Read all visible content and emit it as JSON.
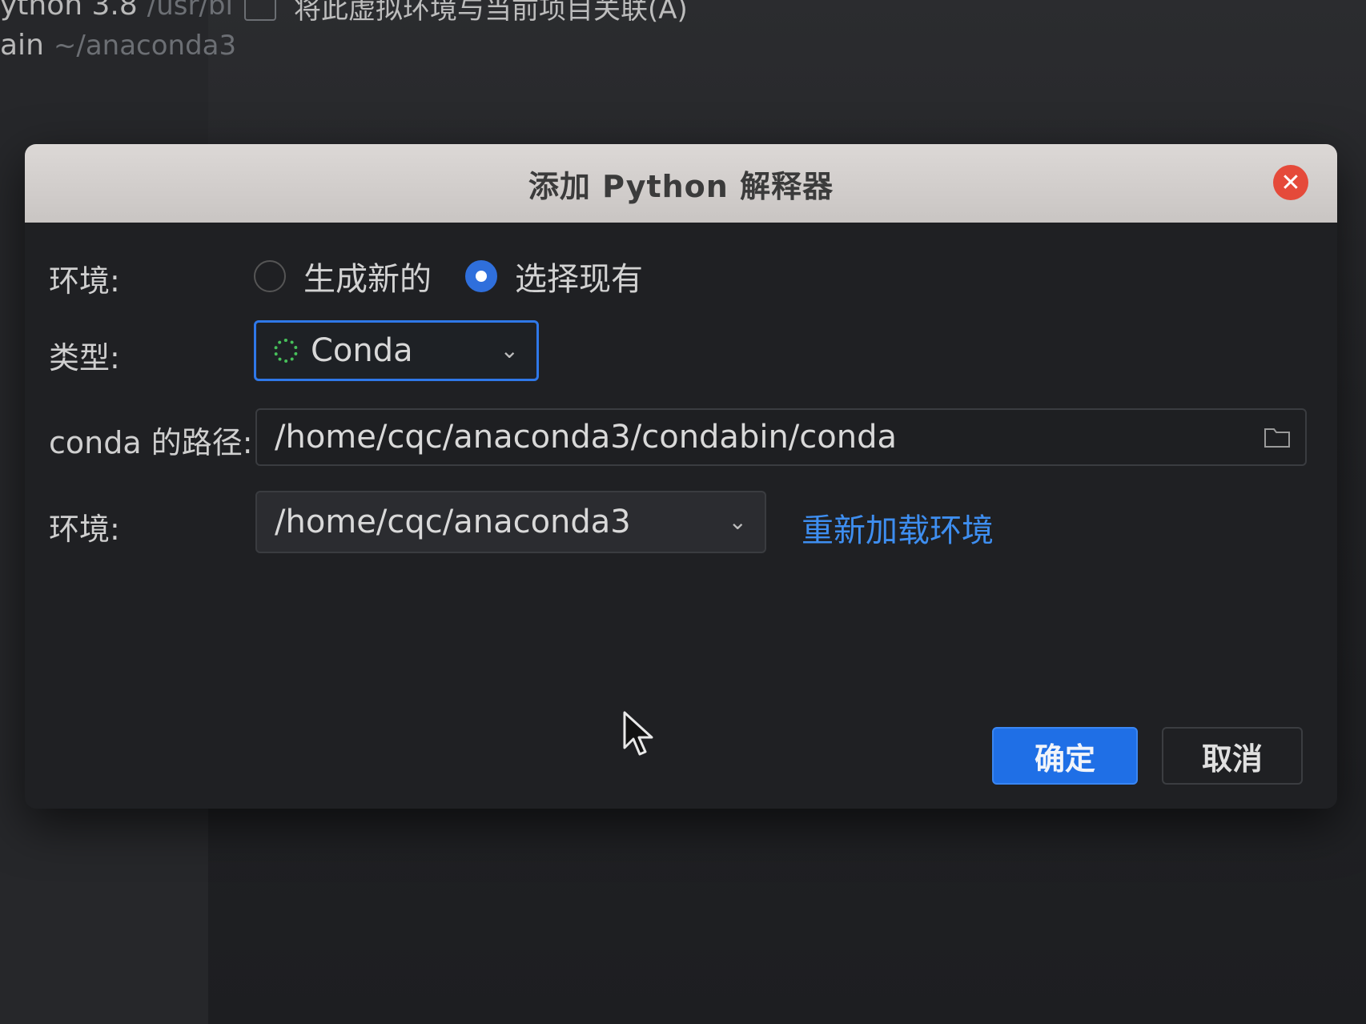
{
  "background": {
    "sidebar_items": [
      {
        "name": "ython 3.8",
        "path": "/usr/bi"
      },
      {
        "name": "ain",
        "path": "~/anaconda3"
      }
    ],
    "checkbox_label": "将此虚拟环境与当前项目关联(A)"
  },
  "dialog": {
    "title": "添加 Python 解释器",
    "environment_label": "环境:",
    "radio_new": "生成新的",
    "radio_existing": "选择现有",
    "type_label": "类型:",
    "type_value": "Conda",
    "conda_path_label": "conda 的路径:",
    "conda_path_value": "/home/cqc/anaconda3/condabin/conda",
    "env_label": "环境:",
    "env_value": "/home/cqc/anaconda3",
    "reload_link": "重新加载环境",
    "ok_button": "确定",
    "cancel_button": "取消"
  },
  "colors": {
    "accent": "#1f6fe6",
    "link": "#3e8ef0",
    "close": "#e54a3a",
    "conda_icon": "#47c05a"
  }
}
